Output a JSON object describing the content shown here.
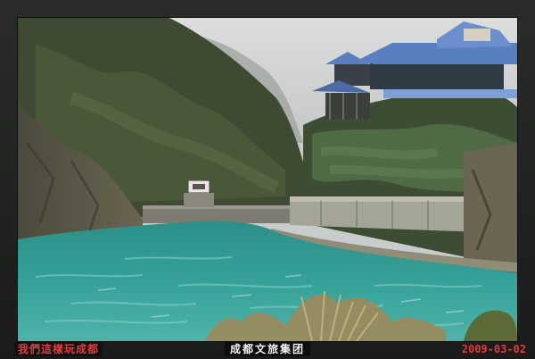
{
  "watermark": {
    "left_text": "我們這樣玩成都",
    "center_text": "成都文旅集团",
    "date_text": "2009-03-02"
  },
  "colors": {
    "caption_red": "#e23a3a",
    "caption_white": "#f2f2f2",
    "water": "#2f9c94",
    "roof": "#5a7fc0"
  }
}
